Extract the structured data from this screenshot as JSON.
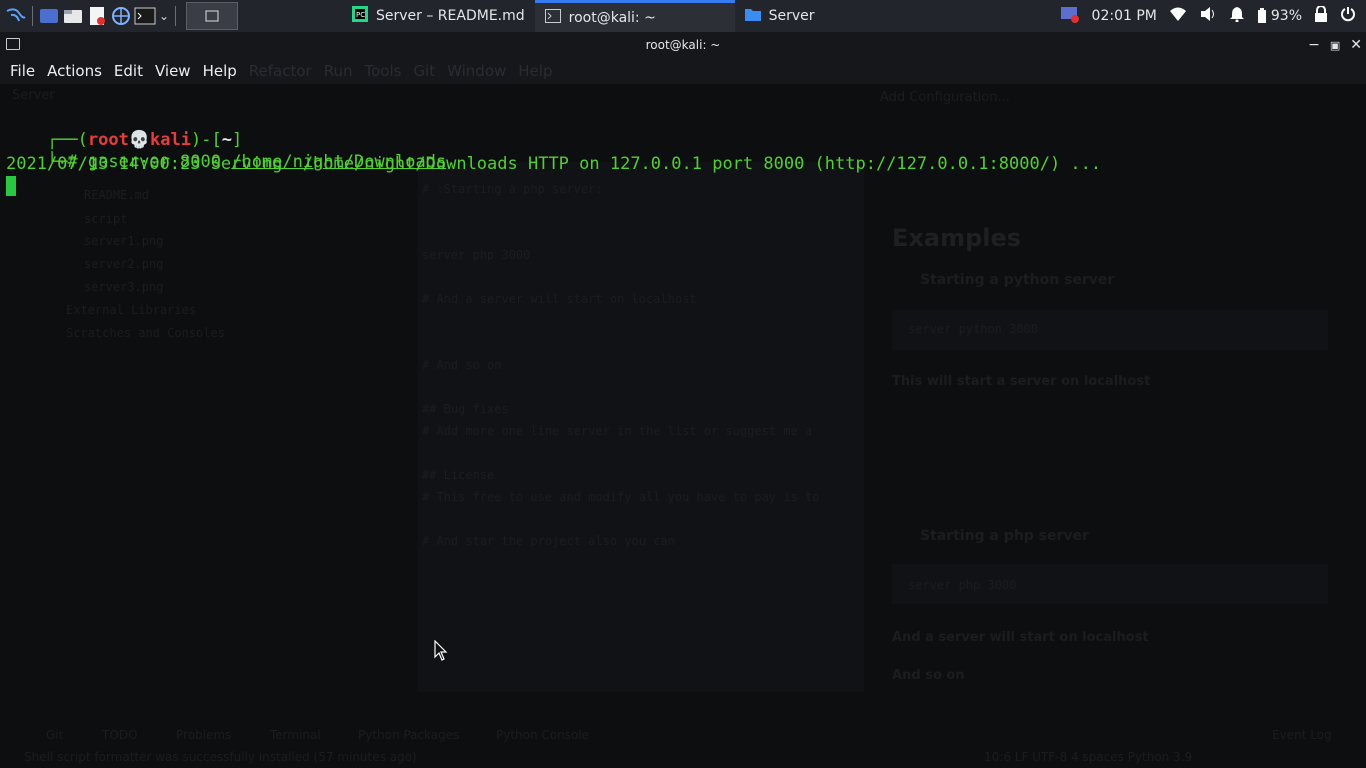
{
  "taskbar": {
    "tasks": [
      {
        "label": "Server – README.md",
        "icon": "pycharm-icon"
      },
      {
        "label": "root@kali: ~",
        "icon": "terminal-icon"
      },
      {
        "label": "Server",
        "icon": "folder-icon"
      }
    ],
    "tray": {
      "clock": "02:01 PM",
      "battery": "93%"
    }
  },
  "window": {
    "title": "root@kali: ~"
  },
  "menu": [
    "File",
    "Actions",
    "Edit",
    "View",
    "Help"
  ],
  "ghost_menu": [
    "Refactor",
    "Run",
    "Tools",
    "Git",
    "Window",
    "Help"
  ],
  "terminal": {
    "prompt": {
      "open": "┌──(",
      "user": "root",
      "skull": "💀",
      "host": "kali",
      "close": ")-[",
      "path": "~",
      "end": "]",
      "line2": "└─#"
    },
    "command": {
      "cmd": "goserver 8000 ",
      "arg": "/home/night/Downloads"
    },
    "output": "2021/07/13 14:00:23 Serving  /home/night/Downloads HTTP on 127.0.0.1 port 8000 (http://127.0.0.1:8000/) ..."
  },
  "ghost_ide": {
    "project_label": "Server",
    "add_config": "Add Configuration...",
    "files": [
      "README.md",
      "script",
      "server1.png",
      "server2.png",
      "server3.png",
      "External Libraries",
      "Scratches and Consoles"
    ],
    "code": [
      "# :Starting a php server:",
      "server php 3000",
      "# And a server will start on localhost",
      "# And so on",
      "## Bug fixes",
      "# Add more one line server in the list or suggest me a",
      "## License",
      "# This free to use and modify all you have to pay is to",
      "# And star the project also you can"
    ],
    "preview": {
      "heading": "Examples",
      "b1": "Starting a python server",
      "code1": "server python 3000",
      "p1": "This will start a server on localhost",
      "b2": "Starting a php server",
      "code2": "server php 3000",
      "p2": "And a server will start on localhost",
      "p3": "And so on"
    },
    "bottom_tabs": [
      "Git",
      "TODO",
      "Problems",
      "Terminal",
      "Python Packages",
      "Python Console"
    ],
    "event_log": "Event Log",
    "status": "Shell script formatter was successfully installed (57 minutes ago)",
    "status_right": "10:6  LF  UTF-8  4 spaces  Python 3.9"
  }
}
